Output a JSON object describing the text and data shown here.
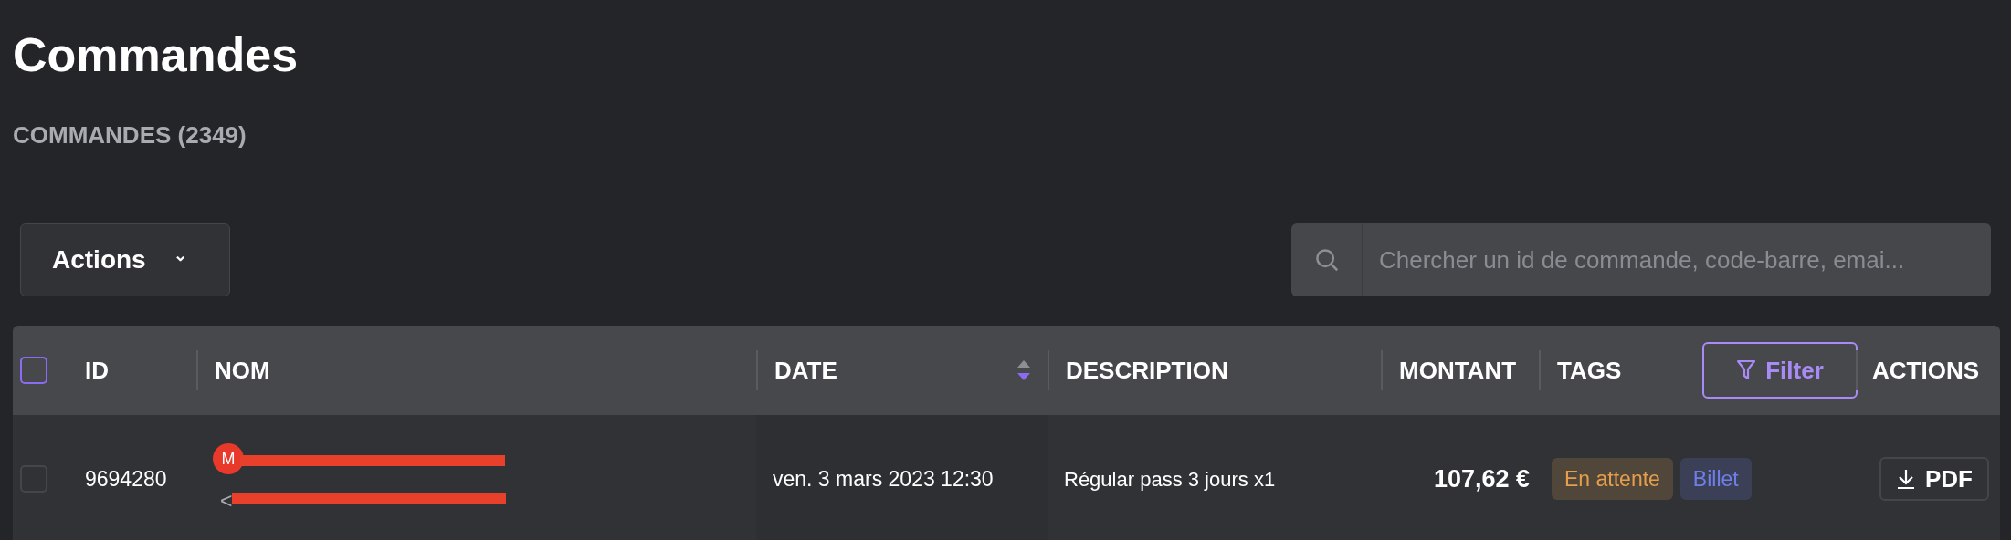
{
  "page": {
    "title": "Commandes",
    "subtitle": "COMMANDES (2349)"
  },
  "toolbar": {
    "actions_button": {
      "label": "Actions",
      "caret": "⌄"
    },
    "search": {
      "placeholder": "Chercher un id de commande, code-barre, emai..."
    }
  },
  "table": {
    "select_all": {
      "checked": false
    },
    "columns": [
      {
        "label": "ID"
      },
      {
        "label": "NOM"
      },
      {
        "label": "DATE",
        "sorted_descending": true
      },
      {
        "label": "DESCRIPTION"
      },
      {
        "label": "MONTANT"
      },
      {
        "label": "TAGS",
        "filter_button": "Filter"
      },
      {
        "label": "ACTIONS"
      }
    ],
    "rows": [
      {
        "checked": false,
        "id": "9694280",
        "avatar": "M",
        "name_visible": "<",
        "date": "ven. 3 mars 2023 12:30",
        "description": "Régular pass 3 jours x1",
        "amount": "107,62 €",
        "tags": [
          {
            "label": "En attente",
            "color": "#e59e4c"
          },
          {
            "label": "Billet",
            "color": "#6f7fe8"
          }
        ],
        "action": "PDF"
      }
    ]
  }
}
